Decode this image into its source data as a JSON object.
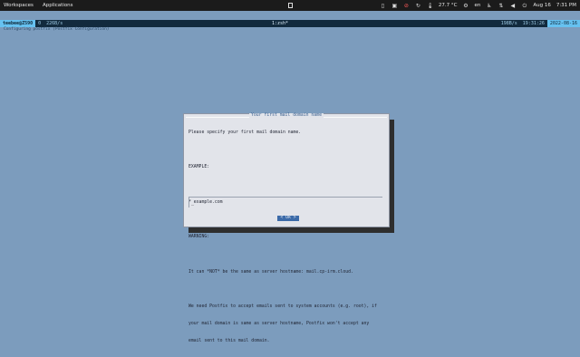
{
  "topbar": {
    "workspaces": "Workspaces",
    "applications": "Applications",
    "temperature": "27.7 °C",
    "keyboard": "en",
    "date": "Aug 16",
    "time": "7:31 PM"
  },
  "tmux": {
    "host": "teebee@Z590",
    "pane": "0",
    "rate_left": "226B/s",
    "window": "1:zsh*",
    "rate_right": "198B/s",
    "clock": "19:31:26",
    "date": "2022-08-16",
    "subline": "Configuring postfix (Postfix Configuration)"
  },
  "dialog": {
    "title": "Your first mail domain name",
    "lines": [
      "Please specify your first mail domain name.",
      "",
      "EXAMPLE:",
      "",
      "* example.com",
      "",
      "WARNING:",
      "",
      "It can *NOT* be the same as server hostname: mail.cp-irm.cloud.",
      "",
      "We need Postfix to accept emails sent to system accounts (e.g. root), if",
      "your mail domain is same as server hostname, Postfix won't accept any",
      "email sent to this mail domain."
    ],
    "input_value": "",
    "ok_label": "< Ok >"
  }
}
